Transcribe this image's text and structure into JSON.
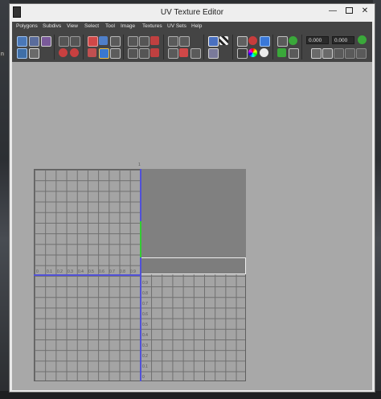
{
  "window": {
    "title": "UV Texture Editor"
  },
  "menubar": {
    "items": [
      "Polygons",
      "Subdivs",
      "View",
      "Select",
      "Tool",
      "Image",
      "Textures",
      "UV Sets",
      "Help"
    ]
  },
  "toolbar": {
    "field1_value": "0.000",
    "field2_value": "0.000"
  },
  "canvas": {
    "top_tick": "1",
    "h_ticks": [
      "0",
      "0.1",
      "0.2",
      "0.3",
      "0.4",
      "0.5",
      "0.6",
      "0.7",
      "0.8",
      "0.9"
    ],
    "v_ticks": [
      "0.9",
      "0.8",
      "0.7",
      "0.6",
      "0.5",
      "0.4",
      "0.3",
      "0.2",
      "0.1",
      "0"
    ]
  },
  "background": {
    "corner_label": "n"
  }
}
